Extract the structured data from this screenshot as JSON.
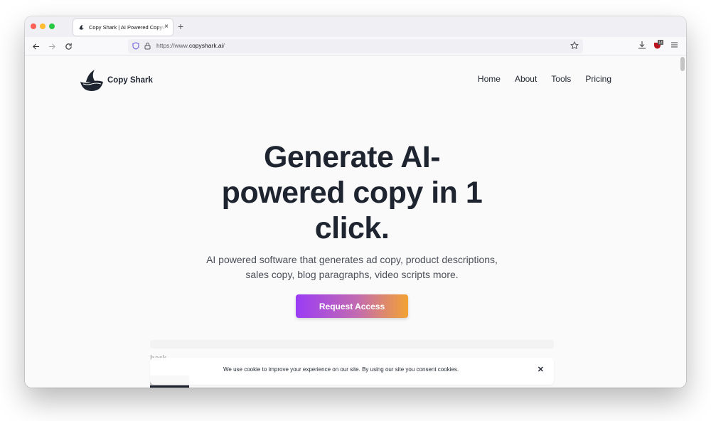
{
  "browser": {
    "tab": {
      "title": "Copy Shark | AI Powered Copywriter",
      "favicon": "shark-fin-icon"
    },
    "new_tab": "+",
    "close_tab": "×",
    "url": {
      "prefix": "https://www.",
      "domain": "copyshark.ai",
      "suffix": "/"
    },
    "extension_badge": "14",
    "icons": [
      "back-icon",
      "forward-icon",
      "reload-icon",
      "shield-icon",
      "lock-icon",
      "bookmark-star-icon",
      "download-icon",
      "extension-icon",
      "menu-icon"
    ]
  },
  "site": {
    "logo_text": "Copy Shark",
    "nav": [
      {
        "label": "Home"
      },
      {
        "label": "About"
      },
      {
        "label": "Tools"
      },
      {
        "label": "Pricing"
      }
    ],
    "hero": {
      "title_lines": [
        "Generate AI-",
        "powered copy in 1",
        "click."
      ],
      "subtitle_lines": [
        "AI powered software that generates ad copy, product descriptions,",
        "sales copy, blog paragraphs, video scripts more."
      ],
      "cta_label": "Request Access"
    },
    "preview": {
      "partial_text": "hark"
    },
    "cookie_banner": {
      "text": "We use cookie to improve your experience on our site. By using our site you consent cookies.",
      "close_label": "✕"
    }
  },
  "colors": {
    "text_dark": "#1f2530",
    "cta_gradient_start": "#9a3cf5",
    "cta_gradient_end": "#f3a233",
    "page_bg": "#fafafa"
  }
}
